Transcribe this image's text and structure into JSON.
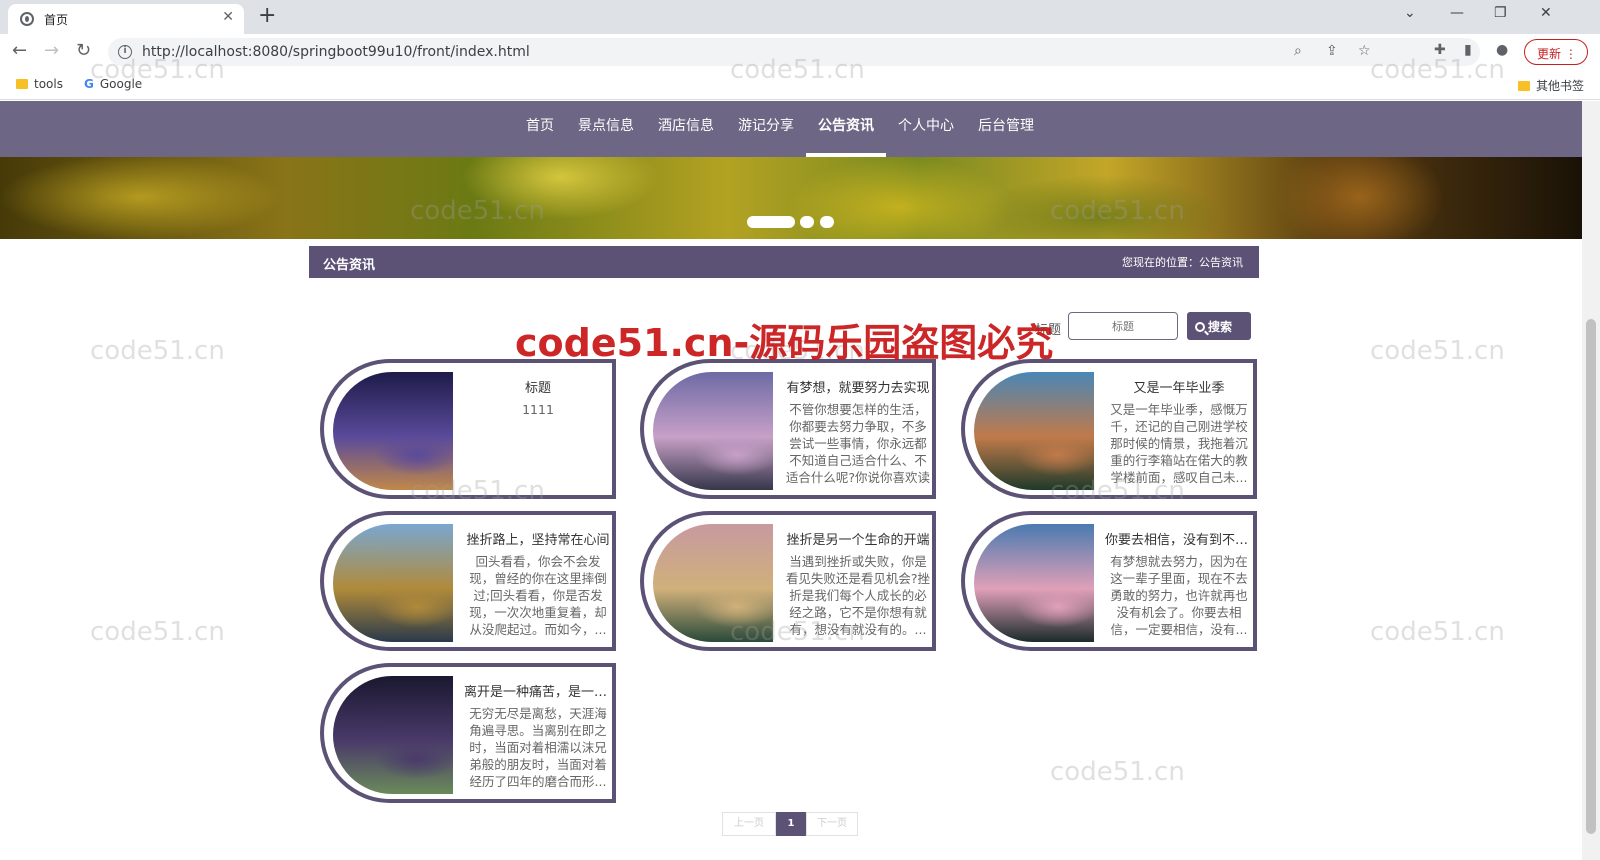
{
  "browser": {
    "tab_title": "首页",
    "tab_close": "✕",
    "new_tab": "+",
    "url": "http://localhost:8080/springboot99u10/front/index.html",
    "update_label": "更新",
    "bookmarks": [
      "tools",
      "Google"
    ],
    "other_bookmarks": "其他书签"
  },
  "nav": {
    "items": [
      "首页",
      "景点信息",
      "酒店信息",
      "游记分享",
      "公告资讯",
      "个人中心",
      "后台管理"
    ],
    "active_index": 4
  },
  "banner": {
    "slide_count": 3,
    "active_slide": 0
  },
  "breadcrumb": {
    "title": "公告资讯",
    "location": "您现在的位置：公告资讯"
  },
  "search": {
    "label": "标题",
    "placeholder": "标题",
    "button": "搜索"
  },
  "cards": [
    {
      "title": "标题",
      "desc": "1111",
      "image": "hotel-night",
      "colors": [
        "#1e1b4a",
        "#5a4a9a",
        "#c0884a"
      ]
    },
    {
      "title": "有梦想，就要努力去实现",
      "desc": "不管你想要怎样的生活，你都要去努力争取，不多尝试一些事情，你永远都不知道自己适合什么、不适合什么呢?你说你喜欢读书，让...",
      "image": "sunset-pier",
      "colors": [
        "#6d6aa5",
        "#c7a0c7",
        "#35364a"
      ]
    },
    {
      "title": "又是一年毕业季",
      "desc": "又是一年毕业季，感慨万千，还记的自己刚进学校那时候的情景，我拖着沉重的行李箱站在偌大的教学楼前面，感叹自己未...",
      "image": "island-castle",
      "colors": [
        "#4a86b5",
        "#c07a4a",
        "#1e3a2a"
      ]
    },
    {
      "title": "挫折路上，坚持常在心间",
      "desc": "回头看看，你会不会发现，曾经的你在这里摔倒过;回头看看，你是否发现，一次次地重复着，却从没爬起过。而如今，...",
      "image": "mountain-road",
      "colors": [
        "#7aa7d0",
        "#b08a3a",
        "#2a3a4a"
      ]
    },
    {
      "title": "挫折是另一个生命的开端",
      "desc": "当遇到挫折或失败，你是看见失败还是看见机会?挫折是我们每个人成长的必经之路，它不是你想有就有，想没有就没有的。...",
      "image": "island-temple",
      "colors": [
        "#c79aa0",
        "#d0b07a",
        "#2a4a3a"
      ]
    },
    {
      "title": "你要去相信，没有到不了的明天",
      "desc": "有梦想就去努力，因为在这一辈子里面，现在不去勇敢的努力，也许就再也没有机会了。你要去相信，一定要相信，没有...",
      "image": "pink-clouds",
      "colors": [
        "#4a7ab0",
        "#e0a0b8",
        "#1a2a2a"
      ]
    },
    {
      "title": "离开是一种痛苦，是一种煎熬",
      "desc": "无穷无尽是离愁，天涯海角遍寻思。当离别在即之时，当面对着相濡以沫兄弟般的朋友时，当面对着经历了四年的磨合而形...",
      "image": "moon-night",
      "colors": [
        "#1a1830",
        "#4a3a6a",
        "#6a8a5a"
      ]
    }
  ],
  "pager": {
    "prev": "上一页",
    "current": "1",
    "next": "下一页"
  },
  "watermarks": {
    "light": "code51.cn",
    "red": "code51.cn-源码乐园盗图必究"
  },
  "colors": {
    "primary": "#5b5275",
    "nav_bg": "#6d6685"
  }
}
